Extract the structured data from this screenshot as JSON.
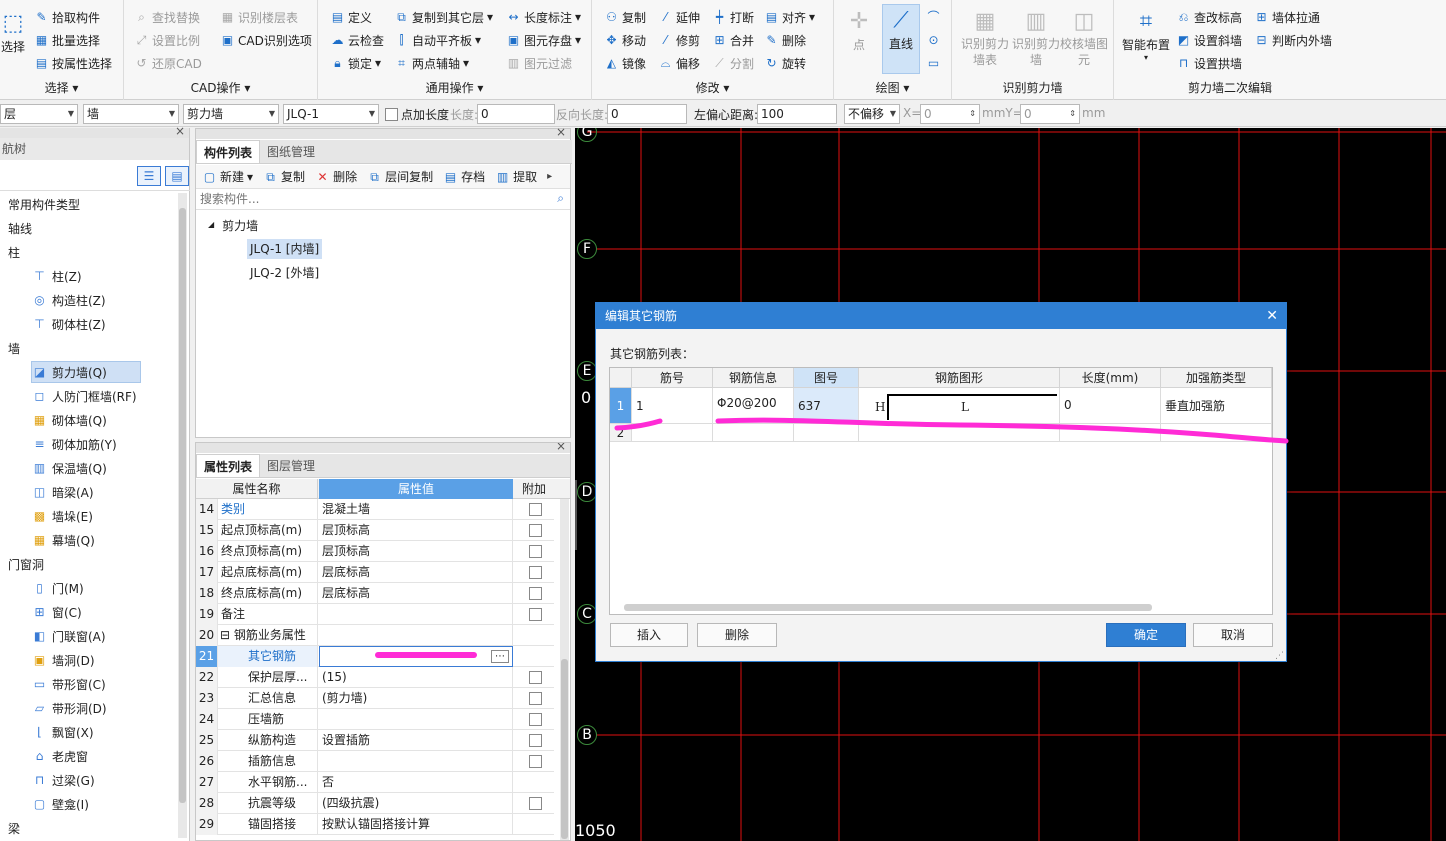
{
  "ribbon": {
    "select_group": {
      "big_label": "选择",
      "items": [
        "拾取构件",
        "批量选择",
        "按属性选择"
      ],
      "title": "选择"
    },
    "cad_group": {
      "items": [
        "查找替换",
        "识别楼层表",
        "设置比例",
        "CAD识别选项",
        "还原CAD"
      ],
      "title": "CAD操作"
    },
    "general_group": {
      "items": [
        "定义",
        "复制到其它层",
        "长度标注",
        "云检查",
        "自动平齐板",
        "图元存盘",
        "锁定",
        "两点辅轴",
        "图元过滤"
      ],
      "title": "通用操作"
    },
    "modify_group": {
      "items": [
        "复制",
        "延伸",
        "打断",
        "对齐",
        "移动",
        "修剪",
        "合并",
        "删除",
        "镜像",
        "偏移",
        "分割",
        "旋转"
      ],
      "title": "修改"
    },
    "draw_group": {
      "items": [
        "点",
        "直线"
      ],
      "title": "绘图"
    },
    "recognize_group": {
      "items": [
        "识别剪力墙表",
        "识别剪力墙",
        "校核墙图元"
      ],
      "title": "识别剪力墙"
    },
    "edit_group": {
      "items": [
        "智能布置",
        "查改标高",
        "墙体拉通",
        "设置斜墙",
        "判断内外墙",
        "设置拱墙"
      ],
      "title": "剪力墙二次编辑"
    }
  },
  "toolbar": {
    "floor": "层",
    "category": "墙",
    "type": "剪力墙",
    "component": "JLQ-1",
    "point_length_label": "点加长度",
    "length_label": "长度:",
    "length_value": "0",
    "reverse_length_label": "反向长度:",
    "reverse_length_value": "0",
    "left_offset_label": "左偏心距离:",
    "left_offset_value": "100",
    "offset_mode": "不偏移",
    "x_label": "X=",
    "x_value": "0",
    "mmy_label": "mmY=",
    "y_value": "0",
    "mm_label": "mm"
  },
  "nav": {
    "title": "航树",
    "items": [
      "常用构件类型",
      "轴线",
      "柱",
      "柱(Z)",
      "构造柱(Z)",
      "砌体柱(Z)",
      "墙",
      "剪力墙(Q)",
      "人防门框墙(RF)",
      "砌体墙(Q)",
      "砌体加筋(Y)",
      "保温墙(Q)",
      "暗梁(A)",
      "墙垛(E)",
      "幕墙(Q)",
      "门窗洞",
      "门(M)",
      "窗(C)",
      "门联窗(A)",
      "墙洞(D)",
      "带形窗(C)",
      "带形洞(D)",
      "飘窗(X)",
      "老虎窗",
      "过梁(G)",
      "壁龛(I)",
      "梁"
    ]
  },
  "component_list": {
    "tabs": [
      "构件列表",
      "图纸管理"
    ],
    "actions": [
      "新建",
      "复制",
      "删除",
      "层间复制",
      "存档",
      "提取"
    ],
    "search_placeholder": "搜索构件...",
    "tree_root": "剪力墙",
    "items": [
      "JLQ-1 [内墙]",
      "JLQ-2 [外墙]"
    ]
  },
  "properties": {
    "tabs": [
      "属性列表",
      "图层管理"
    ],
    "headers": [
      "属性名称",
      "属性值",
      "附加"
    ],
    "rows": [
      {
        "no": "14",
        "name": "类别",
        "value": "混凝土墙"
      },
      {
        "no": "15",
        "name": "起点顶标高(m)",
        "value": "层顶标高"
      },
      {
        "no": "16",
        "name": "终点顶标高(m)",
        "value": "层顶标高"
      },
      {
        "no": "17",
        "name": "起点底标高(m)",
        "value": "层底标高"
      },
      {
        "no": "18",
        "name": "终点底标高(m)",
        "value": "层底标高"
      },
      {
        "no": "19",
        "name": "备注",
        "value": ""
      },
      {
        "no": "20",
        "name": "钢筋业务属性",
        "value": ""
      },
      {
        "no": "21",
        "name": "其它钢筋",
        "value": ""
      },
      {
        "no": "22",
        "name": "保护层厚...",
        "value": "(15)"
      },
      {
        "no": "23",
        "name": "汇总信息",
        "value": "(剪力墙)"
      },
      {
        "no": "24",
        "name": "压墙筋",
        "value": ""
      },
      {
        "no": "25",
        "name": "纵筋构造",
        "value": "设置插筋"
      },
      {
        "no": "26",
        "name": "插筋信息",
        "value": ""
      },
      {
        "no": "27",
        "name": "水平钢筋...",
        "value": "否"
      },
      {
        "no": "28",
        "name": "抗震等级",
        "value": "(四级抗震)"
      },
      {
        "no": "29",
        "name": "锚固搭接",
        "value": "按默认锚固搭接计算"
      }
    ]
  },
  "canvas": {
    "axes": [
      "G",
      "F",
      "E",
      "D",
      "C",
      "B"
    ],
    "left_label": "0",
    "bottom_label": "1050"
  },
  "dialog": {
    "title": "编辑其它钢筋",
    "list_label": "其它钢筋列表：",
    "headers": [
      "筋号",
      "钢筋信息",
      "图号",
      "钢筋图形",
      "长度(mm)",
      "加强筋类型"
    ],
    "rows": [
      {
        "idx": "1",
        "bar_no": "1",
        "info": "Φ20@200",
        "fig_no": "637",
        "shape_h": "H",
        "shape_l": "L",
        "length": "0",
        "type": "垂直加强筋"
      },
      {
        "idx": "2",
        "bar_no": "",
        "info": "",
        "fig_no": "",
        "shape_h": "",
        "shape_l": "",
        "length": "",
        "type": ""
      }
    ],
    "buttons": {
      "insert": "插入",
      "delete": "删除",
      "ok": "确定",
      "cancel": "取消"
    }
  },
  "colors": {
    "accent": "#2f7fd3",
    "highlight": "#ff2bd6",
    "grid_line": "#e01010"
  }
}
